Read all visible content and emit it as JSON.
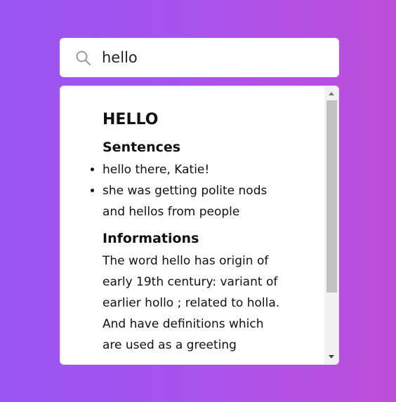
{
  "search": {
    "value": "hello",
    "icon": "search-icon"
  },
  "result": {
    "word": "HELLO",
    "sentences_heading": "Sentences",
    "sentences": [
      "hello there, Katie!",
      "she was getting polite nods and hellos from people"
    ],
    "info_heading": "Informations",
    "info_text": "The word hello has origin of early 19th century: variant of earlier hollo ; related to holla. And have definitions which are used as a greeting"
  }
}
